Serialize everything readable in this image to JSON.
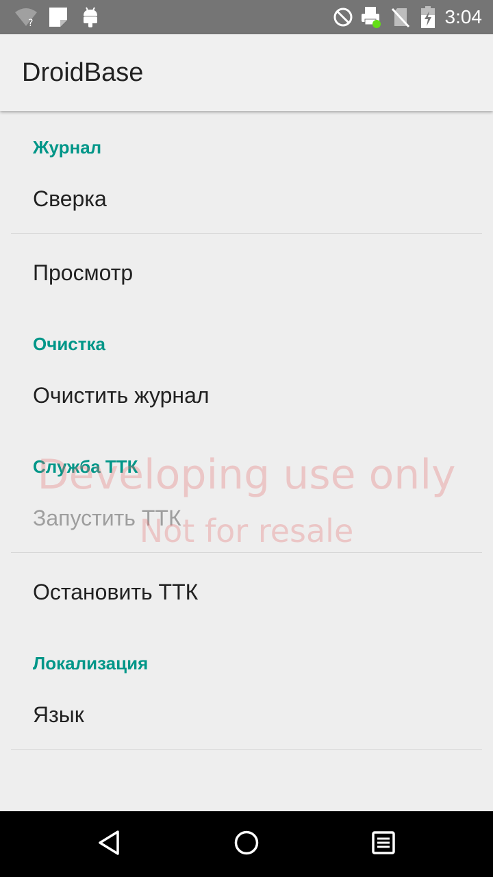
{
  "status_bar": {
    "time": "3:04",
    "icons": [
      "wifi-unknown-icon",
      "notification-icon",
      "android-icon",
      "do-not-disturb-icon",
      "printer-icon",
      "no-sim-icon",
      "battery-charging-icon"
    ]
  },
  "app_bar": {
    "title": "DroidBase"
  },
  "preferences": {
    "journal": {
      "category": "Журнал",
      "reconcile": "Сверка",
      "view": "Просмотр"
    },
    "cleanup": {
      "category": "Очистка",
      "clear_journal": "Очистить журнал"
    },
    "ttk_service": {
      "category": "Служба ТТК",
      "start": "Запустить ТТК",
      "stop": "Остановить ТТК"
    },
    "localization": {
      "category": "Локализация",
      "language": "Язык"
    }
  },
  "watermark": {
    "line1": "Developing use only",
    "line2": "Not for resale"
  },
  "nav_bar": {
    "icons": [
      "back-icon",
      "home-icon",
      "recents-icon"
    ]
  },
  "colors": {
    "accent": "#009688",
    "status_bar": "#757575",
    "background": "#eeeeee",
    "watermark": "#e57373"
  }
}
